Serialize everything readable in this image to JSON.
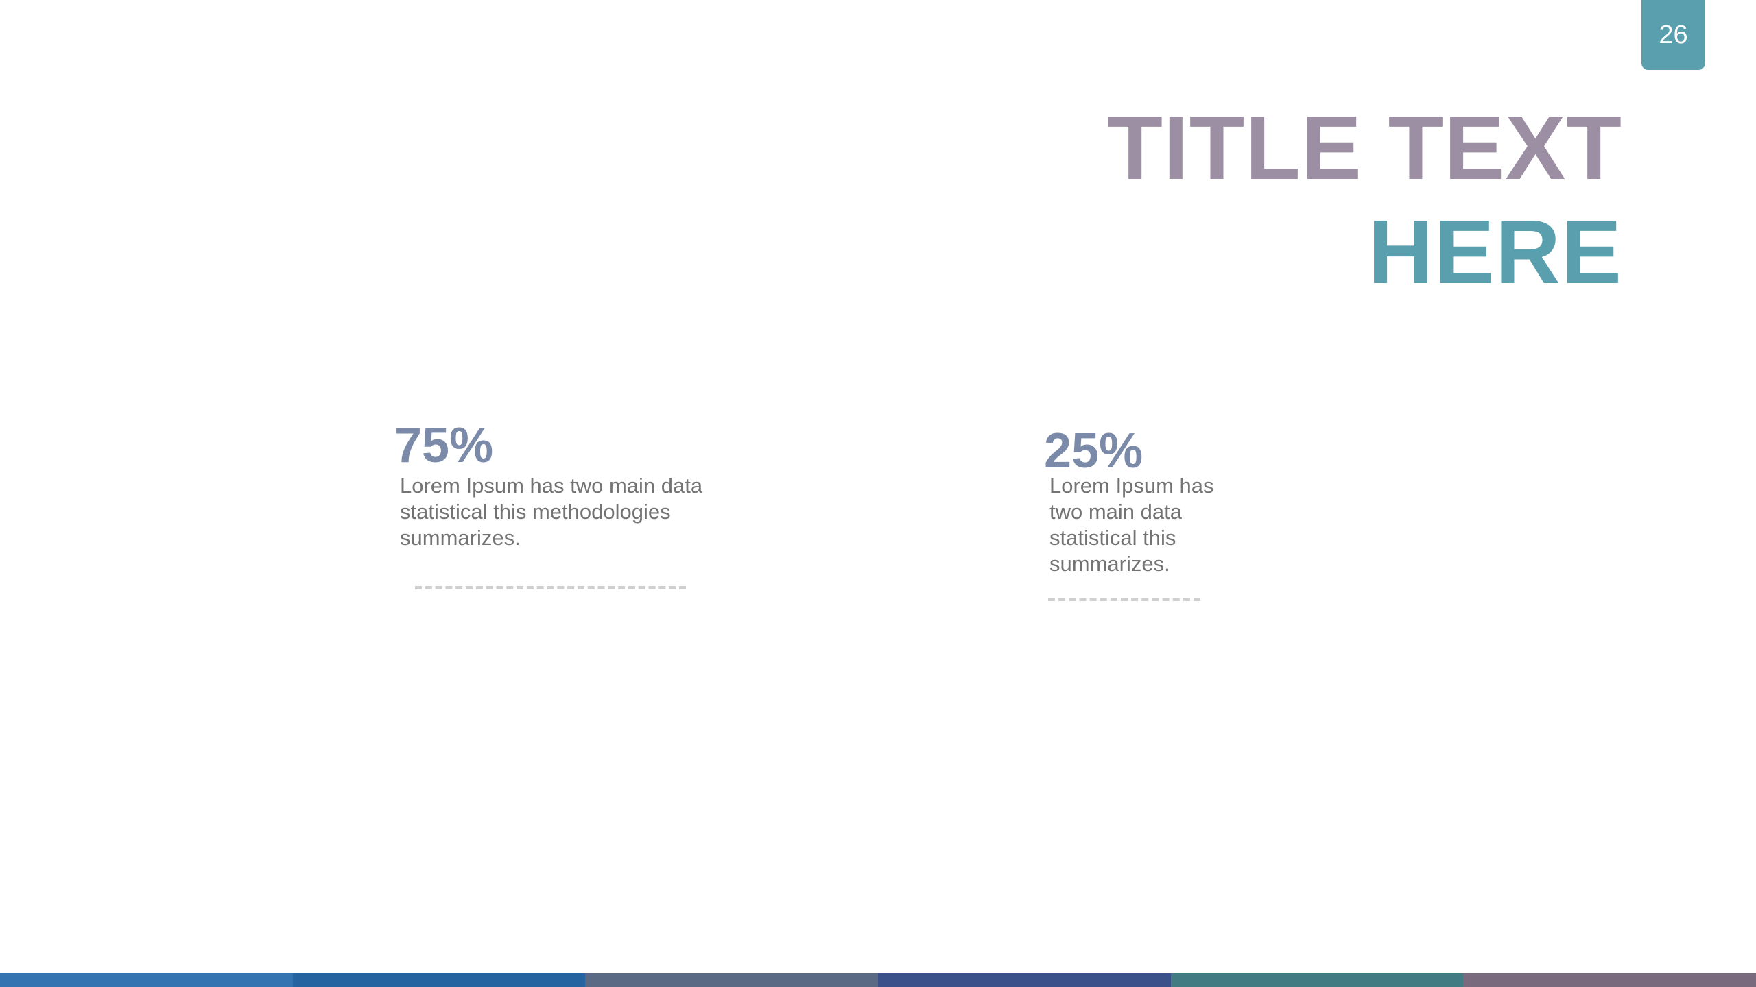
{
  "page_number": "26",
  "title": {
    "line1": "TITLE TEXT",
    "line2": "HERE"
  },
  "stats": [
    {
      "value": "75%",
      "text": "Lorem Ipsum has two main data statistical this methodologies summarizes."
    },
    {
      "value": "25%",
      "text": "Lorem Ipsum has two main data statistical this summarizes."
    }
  ],
  "colors": {
    "accent_teal": "#5a9fae",
    "accent_mauve": "#9c8ea3",
    "stat_value": "#7b8aa8",
    "body_text": "#737373"
  },
  "footer_colors": [
    "#3474b0",
    "#2563a0",
    "#5a6a85",
    "#3a5289",
    "#427c82",
    "#7a6a7e"
  ]
}
